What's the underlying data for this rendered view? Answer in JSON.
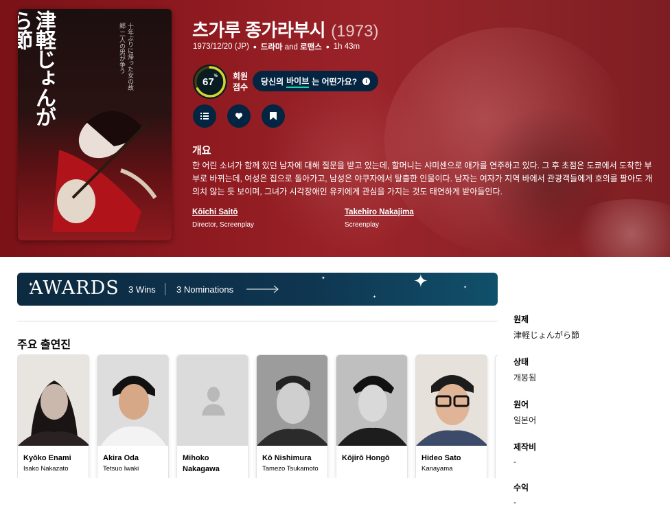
{
  "movie": {
    "title": "츠가루 종가라부시",
    "year": "(1973)",
    "release": "1973/12/20 (JP)",
    "genre_a": "드라마",
    "genre_and": " and ",
    "genre_b": "로맨스",
    "runtime": "1h 43m",
    "score": "67",
    "score_pct": "%",
    "score_value": 0.67,
    "score_label": "회원 점수",
    "vibe_pre": "당신의 ",
    "vibe_u": "바이브",
    "vibe_post": "는 어떤가요?",
    "overview_heading": "개요",
    "overview": "한 어린 소녀가 함께 있던 남자에 대해 질문을 받고 있는데, 할머니는 샤미센으로 애가를 연주하고 있다. 그 후 초점은 도쿄에서 도착한 부부로 바뀌는데, 여성은 집으로 돌아가고, 남성은 야쿠자에서 탈출한 인물이다. 남자는 여자가 지역 바에서 관광객들에게 호의를 팔아도 개의치 않는 듯 보이며, 그녀가 시각장애인 유키에게 관심을 가지는 것도 태연하게 받아들인다.",
    "crew": [
      {
        "name": "Kōichi Saitō",
        "job": "Director, Screenplay"
      },
      {
        "name": "Takehiro Nakajima",
        "job": "Screenplay"
      }
    ],
    "poster_title": "津軽じょんがら節",
    "poster_text": "十年ぶりに帰った女の故郷 二人の男が争う"
  },
  "awards": {
    "title": "AWARDS",
    "wins": "3 Wins",
    "nominations": "3 Nominations"
  },
  "cast": {
    "heading": "주요 출연진",
    "people": [
      {
        "name": "Kyōko Enami",
        "character": "Isako Nakazato"
      },
      {
        "name": "Akira Oda",
        "character": "Tetsuo Iwaki"
      },
      {
        "name": "Mihoko Nakagawa",
        "character": ""
      },
      {
        "name": "Kō Nishimura",
        "character": "Tamezo Tsukamoto"
      },
      {
        "name": "Kōjirō Hongō",
        "character": ""
      },
      {
        "name": "Hideo Sato",
        "character": "Kanayama"
      }
    ]
  },
  "sidebar": {
    "items": [
      {
        "key": "원제",
        "value": "津軽じょんがら節"
      },
      {
        "key": "상태",
        "value": "개봉됨"
      },
      {
        "key": "원어",
        "value": "일본어"
      },
      {
        "key": "제작비",
        "value": "-"
      },
      {
        "key": "수익",
        "value": "-"
      }
    ]
  },
  "colors": {
    "hero": "#8e1a20",
    "navy": "#032541",
    "score_ring": "#d2d531",
    "accent_green": "#1ed5a9"
  }
}
